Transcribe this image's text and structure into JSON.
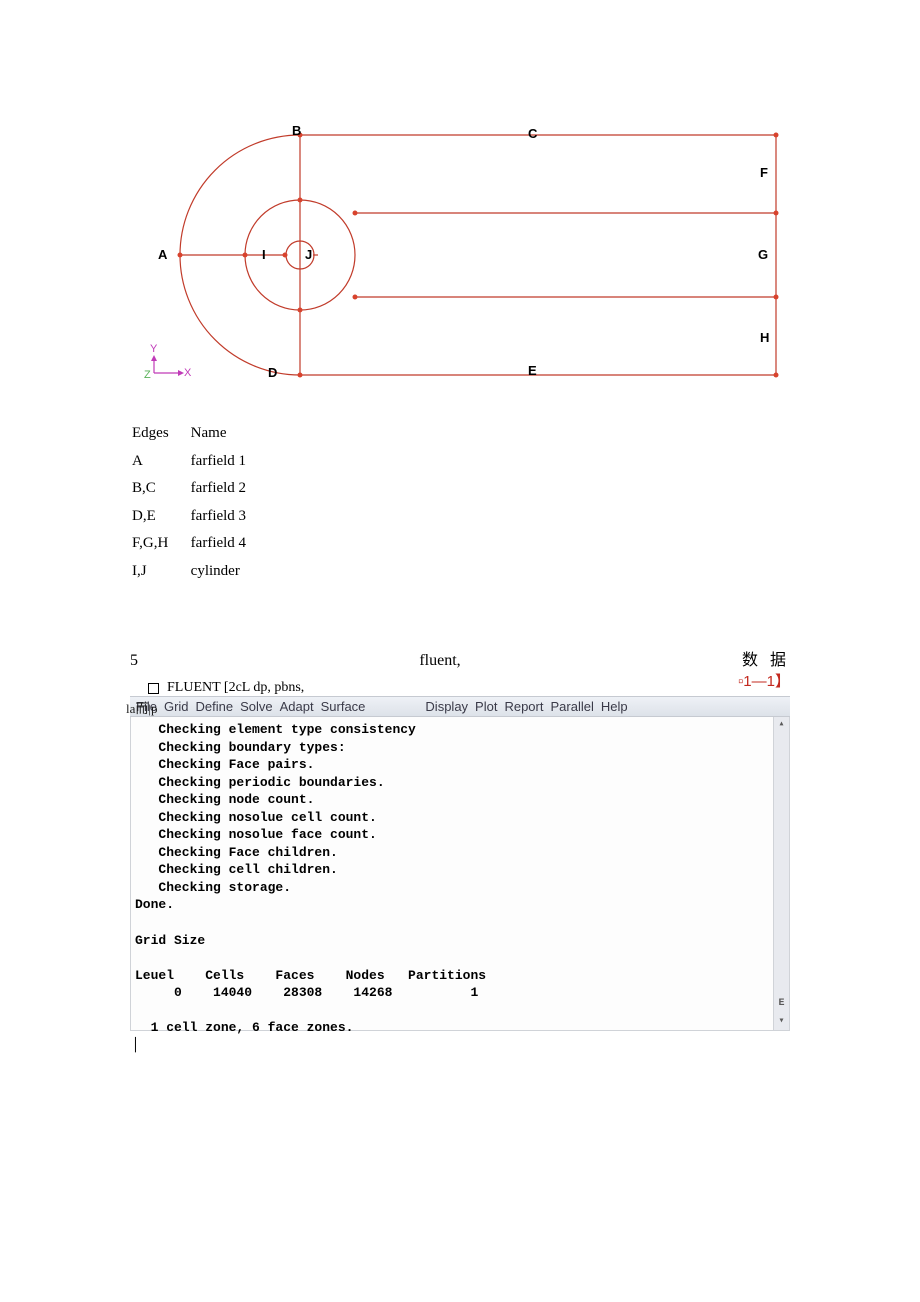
{
  "diagram": {
    "labels": {
      "A": "A",
      "B": "B",
      "C": "C",
      "D": "D",
      "E": "E",
      "F": "F",
      "G": "G",
      "H": "H",
      "I": "I",
      "J": "J"
    },
    "axis": {
      "y": "Y",
      "z": "Z",
      "x": "X"
    }
  },
  "edges_table": {
    "header": {
      "col1": "Edges",
      "col2": "Name"
    },
    "rows": [
      {
        "edges": "A",
        "name": "farfield 1"
      },
      {
        "edges": "B,C",
        "name": "farfield 2"
      },
      {
        "edges": "D,E",
        "name": "farfield 3"
      },
      {
        "edges": "F,G,H",
        "name": "farfield 4"
      },
      {
        "edges": "I,J",
        "name": "cylinder"
      }
    ]
  },
  "section": {
    "step": "5",
    "middle": "fluent,",
    "right_cjk": "数 据"
  },
  "fluent": {
    "title": "FLUENT [2cL dp, pbns,",
    "overlay": "la而|p",
    "window_ctrl": "▫1—1】",
    "menu_left": [
      "File",
      "Grid",
      "Define",
      "Solve",
      "Adapt",
      "Surface"
    ],
    "menu_right": [
      "Display",
      "Plot",
      "Report",
      "Parallel",
      "Help"
    ],
    "console": "   Checking element type consistency\n   Checking boundary types:\n   Checking Face pairs.\n   Checking periodic boundaries.\n   Checking node count.\n   Checking nosolue cell count.\n   Checking nosolue face count.\n   Checking Face children.\n   Checking cell children.\n   Checking storage.\nDone.\n\nGrid Size\n\nLeuel    Cells    Faces    Nodes   Partitions\n     0    14040    28308    14268          1\n\n  1 cell zone, 6 face zones.\n▏"
  }
}
